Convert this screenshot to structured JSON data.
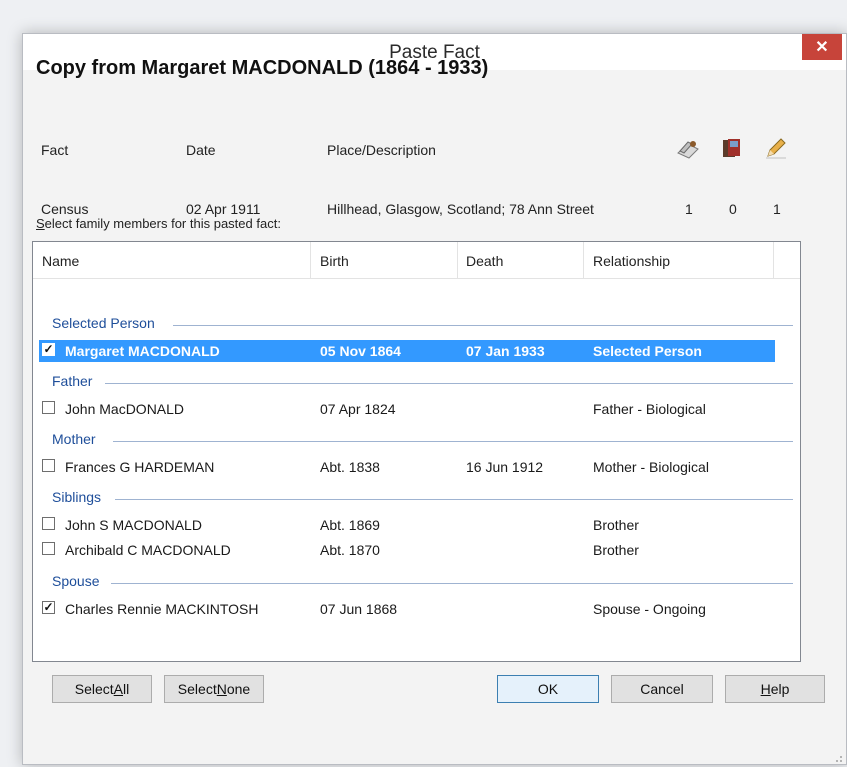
{
  "window": {
    "title": "Paste Fact",
    "close": "✕"
  },
  "heading": "Copy from Margaret MACDONALD (1864 - 1933)",
  "fact_headers": {
    "fact": "Fact",
    "date": "Date",
    "place": "Place/Description"
  },
  "fact_row": {
    "fact": "Census",
    "date": "02 Apr 1911",
    "place": "Hillhead, Glasgow, Scotland; 78 Ann Street",
    "sources": "1",
    "media": "0",
    "notes": "1"
  },
  "select_label": {
    "first": "S",
    "rest": "elect family members for this pasted fact:"
  },
  "columns": {
    "name": "Name",
    "birth": "Birth",
    "death": "Death",
    "relationship": "Relationship"
  },
  "groups": {
    "selected": "Selected Person",
    "father": "Father",
    "mother": "Mother",
    "siblings": "Siblings",
    "spouse": "Spouse"
  },
  "rows": [
    {
      "name": "Margaret MACDONALD",
      "birth": "05 Nov 1864",
      "death": "07 Jan 1933",
      "relationship": "Selected Person",
      "checked": true
    },
    {
      "name": "John MacDONALD",
      "birth": "07 Apr 1824",
      "death": "",
      "relationship": "Father - Biological",
      "checked": false
    },
    {
      "name": "Frances G HARDEMAN",
      "birth": "Abt. 1838",
      "death": "16 Jun 1912",
      "relationship": "Mother - Biological",
      "checked": false
    },
    {
      "name": "John S MACDONALD",
      "birth": "Abt. 1869",
      "death": "",
      "relationship": "Brother",
      "checked": false
    },
    {
      "name": "Archibald C MACDONALD",
      "birth": "Abt. 1870",
      "death": "",
      "relationship": "Brother",
      "checked": false
    },
    {
      "name": "Charles Rennie MACKINTOSH",
      "birth": "07 Jun 1868",
      "death": "",
      "relationship": "Spouse - Ongoing",
      "checked": true
    }
  ],
  "buttons": {
    "select_all": {
      "pre": "Select ",
      "accel": "A",
      "post": "ll"
    },
    "select_none": {
      "pre": "Select ",
      "accel": "N",
      "post": "one"
    },
    "ok": "OK",
    "cancel": "Cancel",
    "help": {
      "pre": "",
      "accel": "H",
      "post": "elp"
    }
  },
  "icons": {
    "sources": "sources-icon",
    "media": "media-icon",
    "notes": "notes-pencil-icon"
  },
  "colors": {
    "selection": "#3399ff",
    "group_text": "#1e4e9a",
    "close": "#c7443a"
  }
}
